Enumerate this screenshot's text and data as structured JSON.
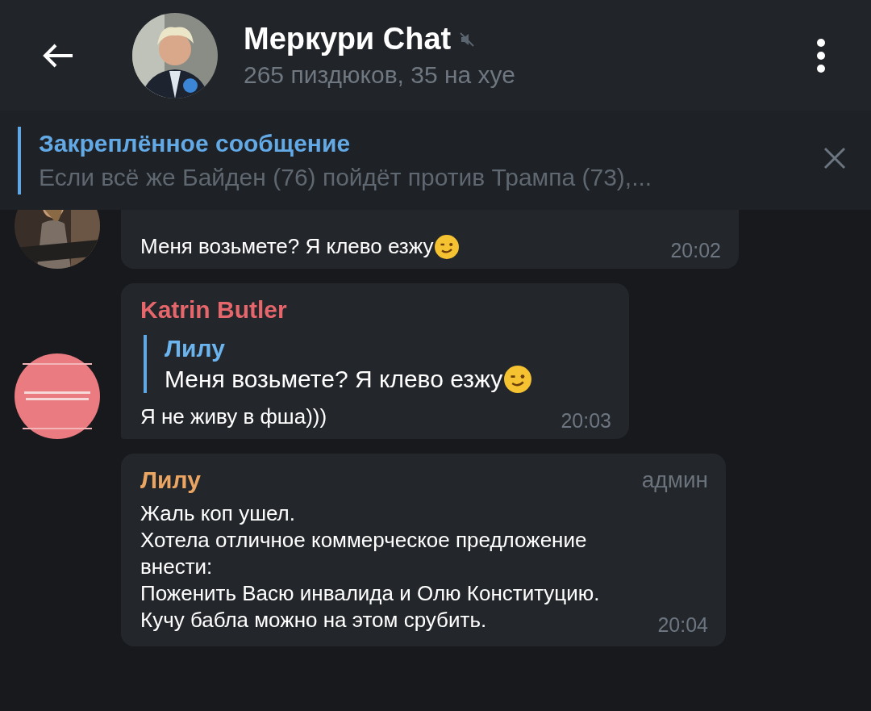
{
  "header": {
    "title": "Меркури Chat",
    "muted": true,
    "subtitle": "265 пиздюков, 35 на хуе"
  },
  "pinned": {
    "label": "Закреплённое сообщение",
    "text": "Если всё же Байден (76) пойдёт против Трампа (73),..."
  },
  "messages": [
    {
      "kind": "plain",
      "text": "Меня возьмете? Я клево езжу",
      "emoji": true,
      "time": "20:02"
    },
    {
      "kind": "reply",
      "sender": "Katrin Butler",
      "color": "#e5666b",
      "reply": {
        "name": "Лилу",
        "text": "Меня возьмете? Я клево езжу",
        "emoji": true
      },
      "text": "Я не живу в фша)))",
      "time": "20:03"
    },
    {
      "kind": "admin",
      "sender": "Лилу",
      "color": "#eaa563",
      "badge": "админ",
      "lines": [
        "Жаль коп ушел.",
        "Хотела отличное коммерческое предложение внести:",
        "Поженить Васю инвалида и Олю Конституцию.",
        "Кучу бабла можно на этом срубить."
      ],
      "time": "20:04"
    }
  ]
}
